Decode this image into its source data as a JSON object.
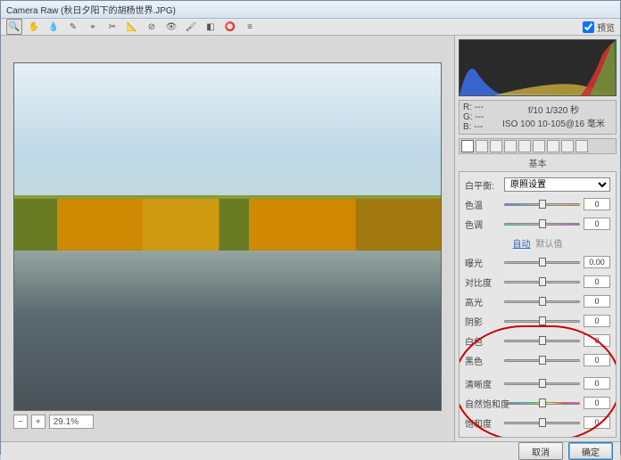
{
  "title": "Camera Raw (秋日夕阳下的胡杨世界.JPG)",
  "toolbar": {
    "preview_label": "预览"
  },
  "status": {
    "zoom": "29.1%"
  },
  "info": {
    "r_label": "R:",
    "g_label": "G:",
    "b_label": "B:",
    "r_val": "---",
    "g_val": "---",
    "b_val": "---",
    "exposure": "f/10  1/320 秒",
    "iso": "ISO 100  10-105@16 毫米"
  },
  "panel": {
    "title": "基本",
    "wb_label": "白平衡:",
    "wb_value": "原照设置",
    "link_auto": "自动",
    "link_default": "默认值",
    "sliders": {
      "temp": {
        "label": "色温",
        "value": "0"
      },
      "tint": {
        "label": "色调",
        "value": "0"
      },
      "exposure": {
        "label": "曝光",
        "value": "0.00"
      },
      "contrast": {
        "label": "对比度",
        "value": "0"
      },
      "highlights": {
        "label": "高光",
        "value": "0"
      },
      "shadows": {
        "label": "阴影",
        "value": "0"
      },
      "whites": {
        "label": "白色",
        "value": "0"
      },
      "blacks": {
        "label": "黑色",
        "value": "0"
      },
      "clarity": {
        "label": "清晰度",
        "value": "0"
      },
      "vibrance": {
        "label": "自然饱和度",
        "value": "0"
      },
      "saturation": {
        "label": "饱和度",
        "value": "0"
      }
    }
  },
  "footer": {
    "cancel": "取消",
    "ok": "确定"
  },
  "tool_icons": [
    "🔍",
    "✋",
    "👁",
    "✂",
    "⭕",
    "↺",
    "⊟",
    "✎",
    "⌖",
    "◧",
    "⊘",
    "⚙"
  ]
}
